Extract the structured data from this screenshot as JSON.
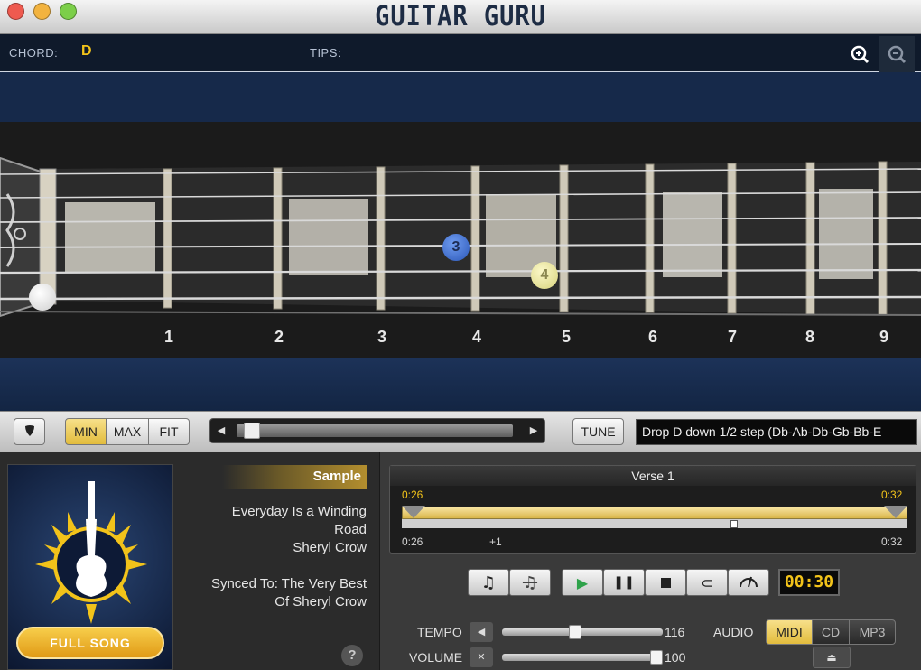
{
  "window": {
    "title": "GUITAR GURU",
    "buttons": {
      "close_color": "#ee5a4f",
      "minimize_color": "#f2b33f",
      "zoom_color": "#7ccf49"
    }
  },
  "chord_bar": {
    "chord_label": "CHORD:",
    "chord_value": "D",
    "tips_label": "TIPS:",
    "zoom_in_icon": "zoom-in-icon",
    "zoom_out_icon": "zoom-out-icon"
  },
  "fretboard": {
    "fret_numbers": [
      "1",
      "2",
      "3",
      "4",
      "5",
      "6",
      "7",
      "8",
      "9"
    ],
    "fingers": [
      {
        "label": "3",
        "color": "#3f6fd1"
      },
      {
        "label": "4",
        "color": "#e8e59a"
      }
    ],
    "open_string_marker_color": "#ffffff"
  },
  "toolbar": {
    "marker_icon": "pick-icon",
    "min_label": "MIN",
    "max_label": "MAX",
    "fit_label": "FIT",
    "selected_zoom": "MIN",
    "tune_label": "TUNE",
    "tuning_value": "Drop D down 1/2 step (Db-Ab-Db-Gb-Bb-E"
  },
  "song_panel": {
    "sample_label": "Sample",
    "song_title_line1": "Everyday Is a Winding",
    "song_title_line2": "Road",
    "artist": "Sheryl Crow",
    "synced_line1": "Synced To: The Very Best",
    "synced_line2": "Of Sheryl Crow",
    "full_song_label": "FULL SONG",
    "help_label": "?"
  },
  "section": {
    "name": "Verse 1",
    "start_time": "0:26",
    "end_time": "0:32",
    "axis_start": "0:26",
    "axis_mid": "+1",
    "axis_end": "0:32"
  },
  "transport": {
    "note_icon": "music-note-icon",
    "note_off_icon": "music-note-off-icon",
    "play_icon": "play-icon",
    "pause_icon": "pause-icon",
    "stop_icon": "stop-icon",
    "loop_icon": "loop-icon",
    "metronome_icon": "metronome-icon",
    "time_display": "00:30"
  },
  "mixer": {
    "tempo_label": "TEMPO",
    "tempo_value": "116",
    "tempo_fraction": 0.45,
    "volume_label": "VOLUME",
    "volume_value": "100",
    "volume_fraction": 1.0,
    "audio_label": "AUDIO",
    "audio_options": [
      "MIDI",
      "CD",
      "MP3"
    ],
    "audio_selected": "MIDI"
  },
  "colors": {
    "accent": "#f2c31a",
    "chord_text": "#f2c31a",
    "highlight": "#f3d56a"
  }
}
